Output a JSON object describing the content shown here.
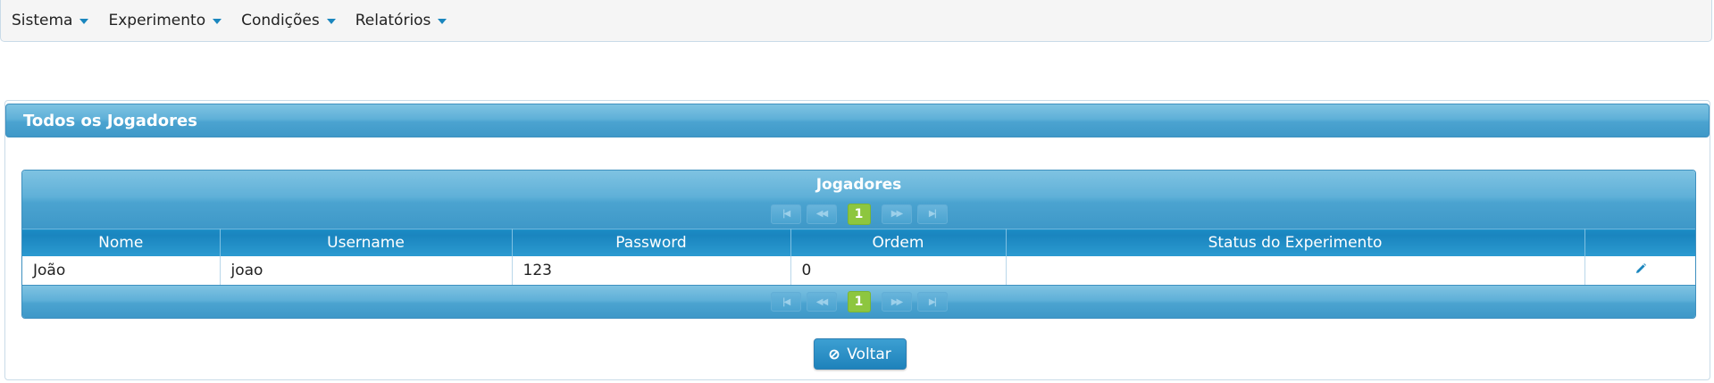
{
  "menu": [
    {
      "label": "Sistema"
    },
    {
      "label": "Experimento"
    },
    {
      "label": "Condições"
    },
    {
      "label": "Relatórios"
    }
  ],
  "panel": {
    "title": "Todos os Jogadores"
  },
  "table": {
    "title": "Jogadores",
    "columns": [
      "Nome",
      "Username",
      "Password",
      "Ordem",
      "Status do Experimento",
      ""
    ],
    "rows": [
      {
        "nome": "João",
        "username": "joao",
        "password": "123",
        "ordem": "0",
        "status": ""
      }
    ],
    "paginator": {
      "first_icon": "first-page-icon",
      "prev_icon": "prev-page-icon",
      "current_page": "1",
      "next_icon": "next-page-icon",
      "last_icon": "last-page-icon"
    },
    "row_action_icon": "pencil-icon"
  },
  "buttons": {
    "back_label": "Voltar",
    "back_icon": "cancel-icon"
  },
  "colors": {
    "header_blue": "#4ba3d0",
    "column_header_blue": "#1a85bf",
    "page_active_green": "#8dc63f",
    "menu_arrow": "#1a86be"
  }
}
